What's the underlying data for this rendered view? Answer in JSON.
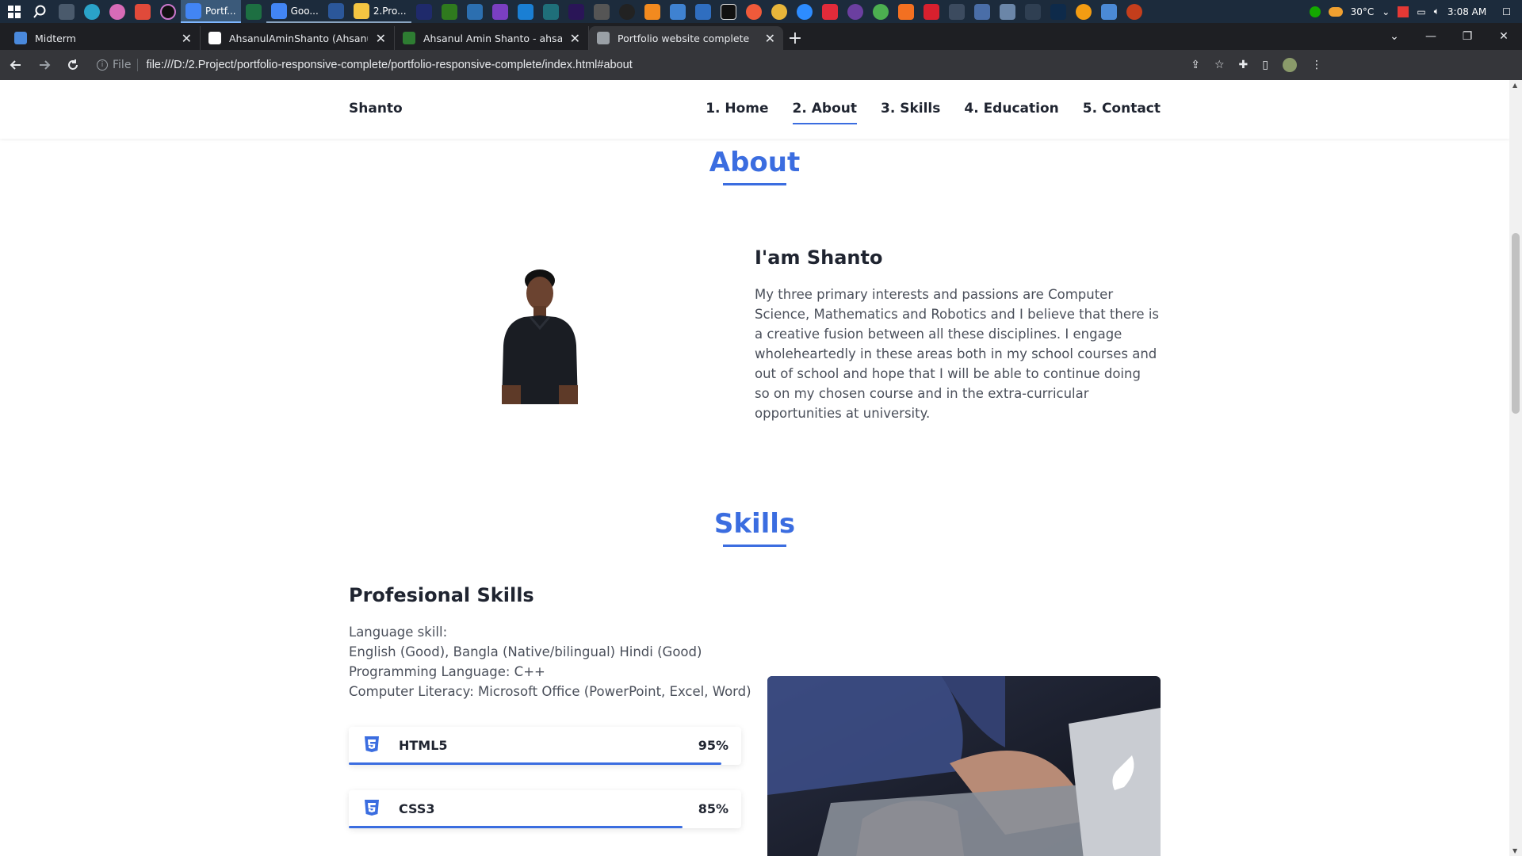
{
  "taskbar": {
    "apps": [
      {
        "name": "chrome-portfolio",
        "label": "Portf...",
        "color": "#4285f4",
        "state": "active"
      },
      {
        "name": "excel",
        "label": "",
        "color": "#1d6f42",
        "state": "none"
      },
      {
        "name": "chrome-google",
        "label": "Goo...",
        "color": "#4285f4",
        "state": "open"
      },
      {
        "name": "word",
        "label": "",
        "color": "#2b579a",
        "state": "open"
      },
      {
        "name": "file-explorer",
        "label": "2.Pro...",
        "color": "#f4c542",
        "state": "open"
      }
    ],
    "temperature": "30°C",
    "time": "3:08 AM"
  },
  "tabs": [
    {
      "title": "Midterm",
      "favicon_color": "#4a89dc",
      "active": false
    },
    {
      "title": "AhsanulAminShanto (Ahsanul Amin Shanto)",
      "favicon_color": "#ffffff",
      "active": false
    },
    {
      "title": "Ahsanul Amin Shanto - ahsanulamin",
      "favicon_color": "#2e7d32",
      "active": false
    },
    {
      "title": "Portfolio website complete",
      "favicon_color": "#9aa0a6",
      "active": true
    }
  ],
  "address_bar": {
    "scheme_label": "File",
    "url": "file:///D:/2.Project/portfolio-responsive-complete/portfolio-responsive-complete/index.html#about"
  },
  "site": {
    "logo": "Shanto",
    "nav": [
      "1. Home",
      "2. About",
      "3. Skills",
      "4. Education",
      "5. Contact"
    ],
    "active_nav": "2. About",
    "accent_color": "#3b6de0",
    "about": {
      "title": "About",
      "heading": "I'am Shanto",
      "paragraph": "My three primary interests and passions are Computer Science, Mathematics and Robotics and I believe that there is a creative fusion between all these disciplines. I engage wholeheartedly in these areas both in my school courses and out of school and hope that I will be able to continue doing so on my chosen course and in the extra-curricular opportunities at university."
    },
    "skills": {
      "title": "Skills",
      "heading": "Profesional Skills",
      "lines": [
        "Language skill:",
        "English (Good), Bangla (Native/bilingual) Hindi (Good)",
        "Programming Language: C++",
        "Computer Literacy: Microsoft Office (PowerPoint, Excel, Word)"
      ],
      "items": [
        {
          "name": "HTML5",
          "percent": "95%",
          "value": 95,
          "icon": "html5-icon"
        },
        {
          "name": "CSS3",
          "percent": "85%",
          "value": 85,
          "icon": "css3-icon"
        }
      ]
    }
  }
}
